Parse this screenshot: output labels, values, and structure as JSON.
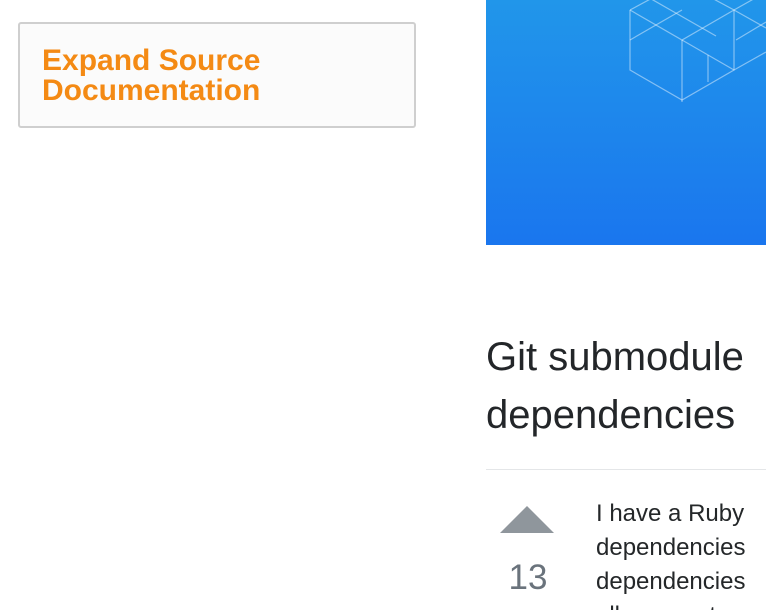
{
  "sidebar": {
    "expand_line1": "Expand Source",
    "expand_line2": "Documentation"
  },
  "question": {
    "title_line1": "Git submodule",
    "title_line2": "dependencies",
    "votes": "13",
    "body_lines": [
      "I have a Ruby",
      "dependencies",
      "dependencies",
      "allows me to o"
    ]
  },
  "banner": {
    "color_top": "#2196ea",
    "color_bottom": "#1a76ee"
  }
}
